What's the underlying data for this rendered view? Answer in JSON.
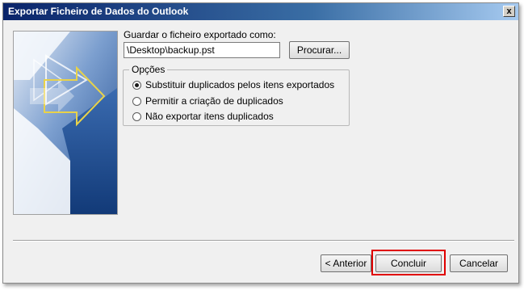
{
  "window": {
    "title": "Exportar Ficheiro de Dados do Outlook",
    "close_label": "x"
  },
  "form": {
    "save_as_label": "Guardar o ficheiro exportado como:",
    "path_value": "\\Desktop\\backup.pst",
    "browse_label": "Procurar..."
  },
  "options": {
    "legend": "Opções",
    "items": [
      {
        "label": "Substituir duplicados pelos itens exportados",
        "checked": true
      },
      {
        "label": "Permitir a criação de duplicados",
        "checked": false
      },
      {
        "label": "Não exportar itens duplicados",
        "checked": false
      }
    ]
  },
  "buttons": {
    "back_label": "< Anterior",
    "finish_label": "Concluir",
    "cancel_label": "Cancelar"
  },
  "colors": {
    "highlight": "#e00000",
    "banner_blue": "#2f5a9e"
  },
  "icons": [
    "close-icon",
    "radio-checked-icon",
    "radio-unchecked-icon",
    "wizard-banner-arrow-icon"
  ]
}
